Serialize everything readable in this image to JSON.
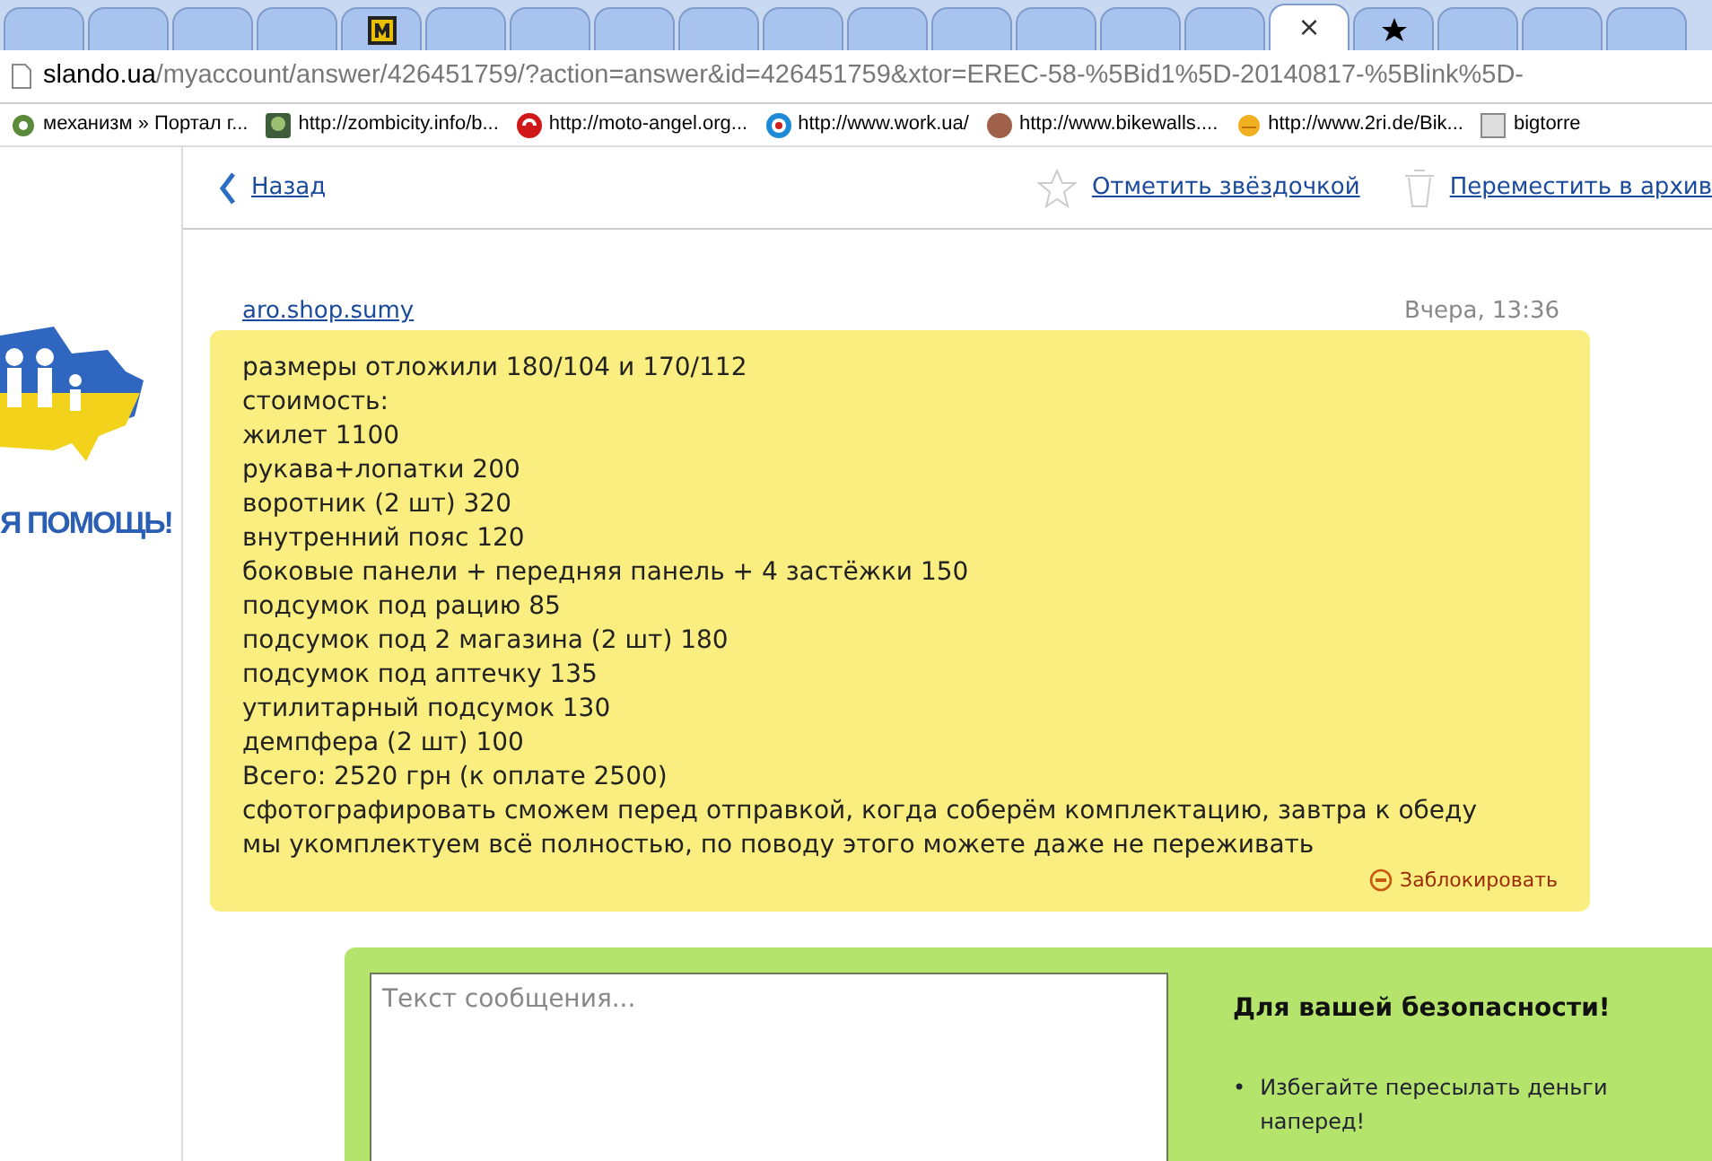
{
  "browser": {
    "tabs": [
      {
        "selected": false,
        "kind": "plain"
      },
      {
        "selected": false,
        "kind": "plain"
      },
      {
        "selected": false,
        "kind": "plain"
      },
      {
        "selected": false,
        "kind": "plain"
      },
      {
        "selected": false,
        "kind": "m"
      },
      {
        "selected": false,
        "kind": "plain"
      },
      {
        "selected": false,
        "kind": "plain"
      },
      {
        "selected": false,
        "kind": "plain"
      },
      {
        "selected": false,
        "kind": "plain"
      },
      {
        "selected": false,
        "kind": "plain"
      },
      {
        "selected": false,
        "kind": "plain"
      },
      {
        "selected": false,
        "kind": "plain"
      },
      {
        "selected": false,
        "kind": "plain"
      },
      {
        "selected": false,
        "kind": "plain"
      },
      {
        "selected": false,
        "kind": "plain"
      },
      {
        "selected": true,
        "kind": "plain",
        "close": "×"
      },
      {
        "selected": false,
        "kind": "star"
      },
      {
        "selected": false,
        "kind": "plain"
      },
      {
        "selected": false,
        "kind": "plain"
      },
      {
        "selected": false,
        "kind": "plain"
      }
    ],
    "address": {
      "host": "slando.ua",
      "path": "/myaccount/answer/426451759/?action=answer&id=426451759&xtor=EREC-58-%5Bid1%5D-20140817-%5Blink%5D-"
    },
    "bookmarks": [
      {
        "label": "механизм » Портал г...",
        "kind": "gear"
      },
      {
        "label": "http://zombicity.info/b...",
        "kind": "zombie"
      },
      {
        "label": "http://moto-angel.org...",
        "kind": "moto"
      },
      {
        "label": "http://www.work.ua/",
        "kind": "target"
      },
      {
        "label": "http://www.bikewalls....",
        "kind": "round"
      },
      {
        "label": "http://www.2ri.de/Bik...",
        "kind": "sun"
      },
      {
        "label": "bigtorre",
        "kind": "bt"
      }
    ]
  },
  "sidebar": {
    "banner_text": "Я ПОМОЩЬ!"
  },
  "toolbar": {
    "back": "Назад",
    "star": "Отметить звёздочкой",
    "archive": "Переместить в архив"
  },
  "message": {
    "sender": "aro.shop.sumy",
    "time": "Вчера, 13:36",
    "lines": [
      "размеры отложили 180/104 и 170/112",
      "стоимость:",
      "жилет 1100",
      "рукава+лопатки 200",
      "воротник (2 шт) 320",
      "внутренний пояс 120",
      "боковые панели + передняя панель + 4 застёжки 150",
      "подсумок под рацию 85",
      "подсумок под 2 магазина (2 шт) 180",
      "подсумок под аптечку 135",
      "утилитарный подсумок 130",
      "демпфера (2 шт) 100",
      "Всего: 2520 грн (к оплате 2500)",
      "сфотографировать сможем перед отправкой, когда соберём комплектацию, завтра к обеду",
      "мы укомплектуем всё полностью, по поводу этого можете даже не переживать"
    ],
    "block": "Заблокировать"
  },
  "reply": {
    "placeholder": "Текст сообщения...",
    "safety_title": "Для вашей безопасности!",
    "tips": [
      {
        "bullet": "•",
        "text": "Избегайте пересылать деньги наперед!"
      }
    ]
  }
}
